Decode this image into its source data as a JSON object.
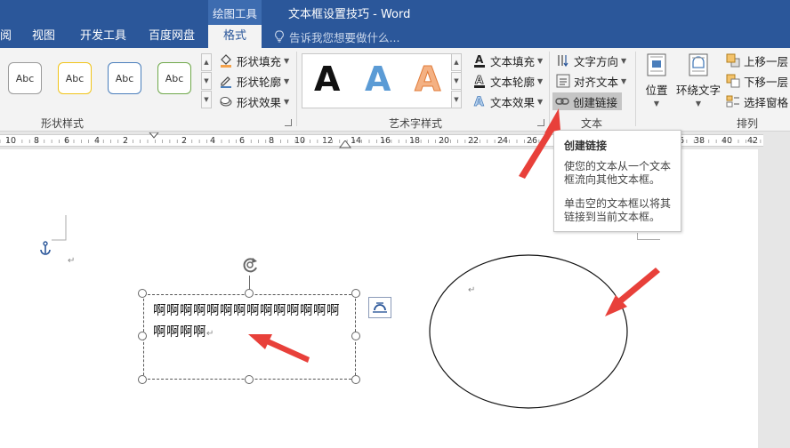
{
  "title_bar": {
    "contextual_tools": "绘图工具",
    "document_title": "文本框设置技巧 - Word"
  },
  "tabs": [
    {
      "label": "阅"
    },
    {
      "label": "视图"
    },
    {
      "label": "开发工具"
    },
    {
      "label": "百度网盘"
    },
    {
      "label": "格式"
    }
  ],
  "tell_me": {
    "placeholder": "告诉我您想要做什么..."
  },
  "ribbon": {
    "shape_styles": {
      "label": "形状样式",
      "samples": [
        "Abc",
        "Abc",
        "Abc",
        "Abc"
      ],
      "fill": "形状填充",
      "outline": "形状轮廓",
      "effects": "形状效果"
    },
    "wordart_styles": {
      "label": "艺术字样式",
      "samples": [
        "A",
        "A",
        "A"
      ],
      "text_fill": "文本填充",
      "text_outline": "文本轮廓",
      "text_effects": "文本效果"
    },
    "text_group": {
      "label": "文本",
      "direction": "文字方向",
      "align": "对齐文本",
      "create_link": "创建链接"
    },
    "arrange": {
      "label": "排列",
      "position": "位置",
      "wrap_text": "环绕文字",
      "bring_forward": "上移一层",
      "send_backward": "下移一层",
      "selection_pane": "选择窗格"
    }
  },
  "ruler": {
    "numbers": [
      "10",
      "8",
      "6",
      "4",
      "2",
      "2",
      "4",
      "6",
      "8",
      "10",
      "12",
      "14",
      "16",
      "18",
      "20",
      "22",
      "24",
      "26",
      "28",
      "30",
      "32",
      "34",
      "36",
      "38",
      "40",
      "42"
    ]
  },
  "tooltip": {
    "title": "创建链接",
    "body1": "使您的文本从一个文本框流向其他文本框。",
    "body2": "单击空的文本框以将其链接到当前文本框。"
  },
  "document": {
    "paragraph_mark": "↵",
    "textbox_text": "啊啊啊啊啊啊啊啊啊啊啊啊啊啊啊啊啊啊",
    "textbox_mark": "↵",
    "ellipse_mark": "↵"
  },
  "colors": {
    "title_bar": "#2b579a",
    "ribbon_bg": "#f3f3f3",
    "arrow_red": "#e8403a",
    "shape_blue": "#4a7ebb",
    "shape_orange": "#f4a24b",
    "shape_green": "#6fa84a",
    "shape_gold": "#f0c419"
  }
}
